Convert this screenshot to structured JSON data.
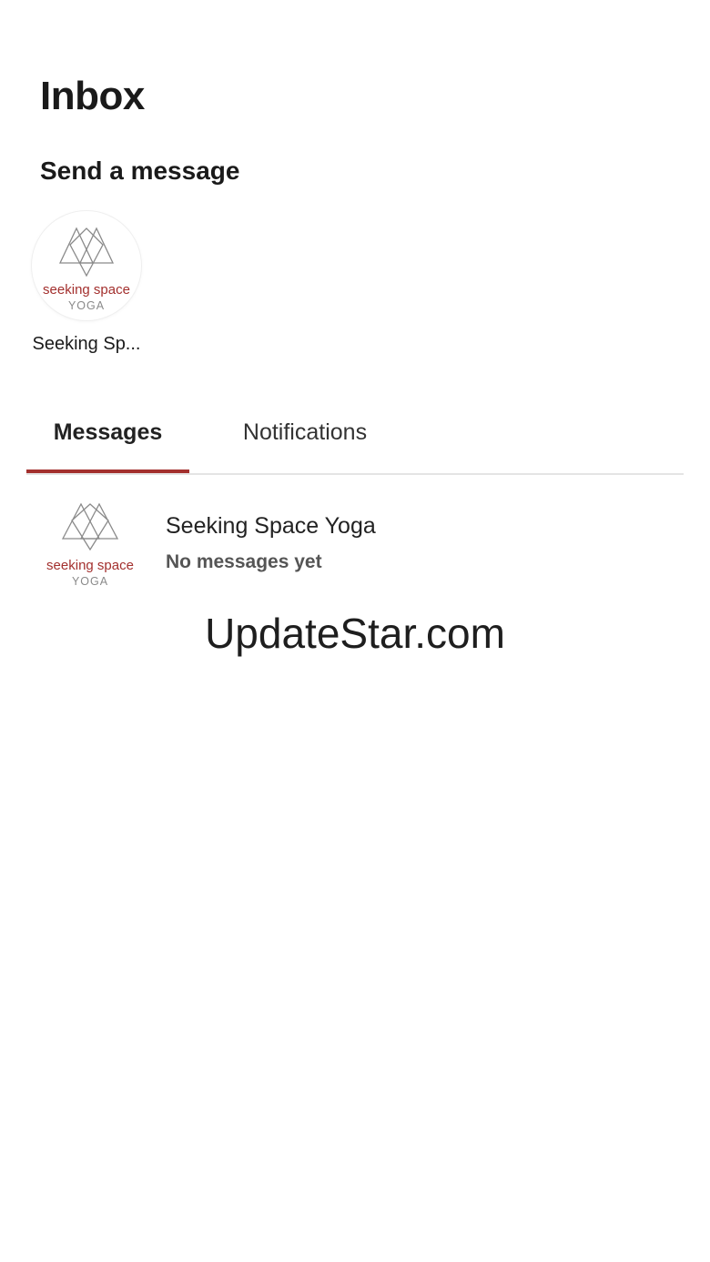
{
  "header": {
    "title": "Inbox"
  },
  "send_message": {
    "title": "Send a message",
    "contacts": [
      {
        "name": "Seeking Sp...",
        "logo": {
          "icon": "seeking-space-yoga-logo",
          "line1": "seeking space",
          "line2": "YOGA",
          "accent_color": "#a3302e"
        }
      }
    ]
  },
  "tabs": [
    {
      "label": "Messages",
      "active": true
    },
    {
      "label": "Notifications",
      "active": false
    }
  ],
  "threads": [
    {
      "name": "Seeking Space Yoga",
      "preview": "No messages yet",
      "logo": {
        "icon": "seeking-space-yoga-logo",
        "line1": "seeking space",
        "line2": "YOGA"
      }
    }
  ],
  "watermark": "UpdateStar.com",
  "colors": {
    "accent": "#a3302e",
    "divider": "#e4e4e4"
  }
}
